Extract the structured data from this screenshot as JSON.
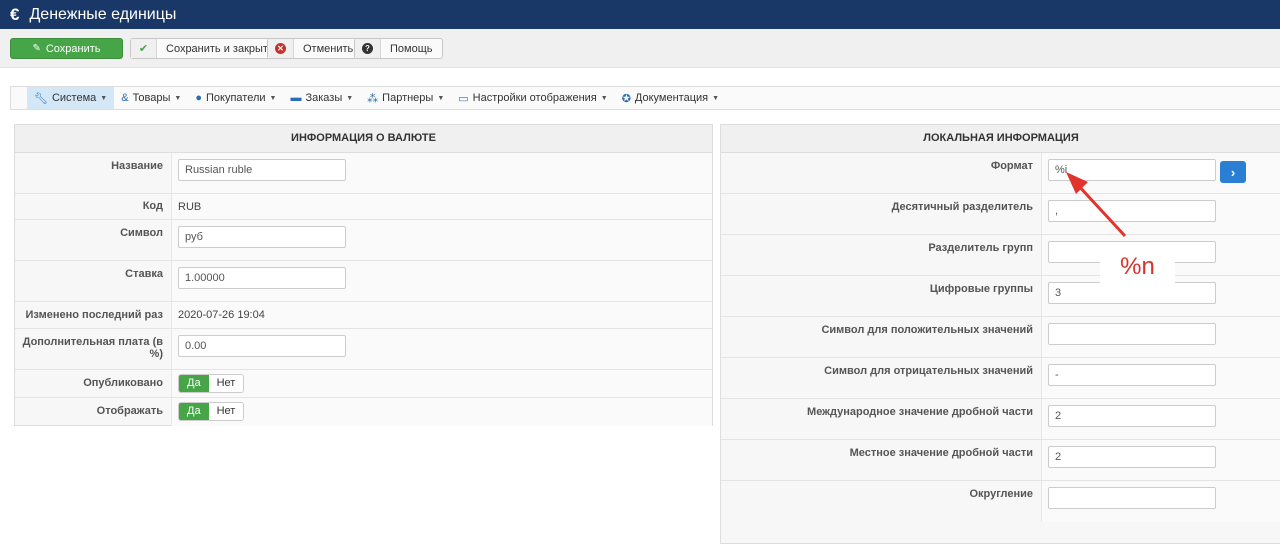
{
  "header": {
    "icon": "euro-icon",
    "title": "Денежные единицы"
  },
  "toolbar": {
    "save": "Сохранить",
    "save_close": "Сохранить и закрыть",
    "cancel": "Отменить",
    "help": "Помощь"
  },
  "menu": [
    {
      "label": "Система",
      "icon": "wrench-icon",
      "active": true
    },
    {
      "label": "Товары",
      "icon": "products-icon"
    },
    {
      "label": "Покупатели",
      "icon": "user-icon"
    },
    {
      "label": "Заказы",
      "icon": "credit-card-icon"
    },
    {
      "label": "Партнеры",
      "icon": "users-icon"
    },
    {
      "label": "Настройки отображения",
      "icon": "monitor-icon"
    },
    {
      "label": "Документация",
      "icon": "lifebuoy-icon"
    }
  ],
  "currency": {
    "title": "ИНФОРМАЦИЯ О ВАЛЮТЕ",
    "name_label": "Название",
    "name": "Russian ruble",
    "code_label": "Код",
    "code": "RUB",
    "symbol_label": "Символ",
    "symbol": "руб",
    "rate_label": "Ставка",
    "rate": "1.00000",
    "modified_label": "Изменено последний раз",
    "modified": "2020-07-26 19:04",
    "fee_label": "Дополнительная плата (в %)",
    "fee": "0.00",
    "published_label": "Опубликовано",
    "displayed_label": "Отображать",
    "yes": "Да",
    "no": "Нет"
  },
  "local": {
    "title": "ЛОКАЛЬНАЯ ИНФОРМАЦИЯ",
    "rows": [
      {
        "label": "Формат",
        "value": "%i"
      },
      {
        "label": "Десятичный разделитель",
        "value": ","
      },
      {
        "label": "Разделитель групп",
        "value": ""
      },
      {
        "label": "Цифровые группы",
        "value": "3"
      },
      {
        "label": "Символ для положительных значений",
        "value": ""
      },
      {
        "label": "Символ для отрицательных значений",
        "value": "-"
      },
      {
        "label": "Международное значение дробной части",
        "value": "2"
      },
      {
        "label": "Местное значение дробной части",
        "value": "2"
      },
      {
        "label": "Округление",
        "value": ""
      }
    ]
  },
  "annotation": {
    "text": "%n",
    "color": "#d9312b"
  }
}
